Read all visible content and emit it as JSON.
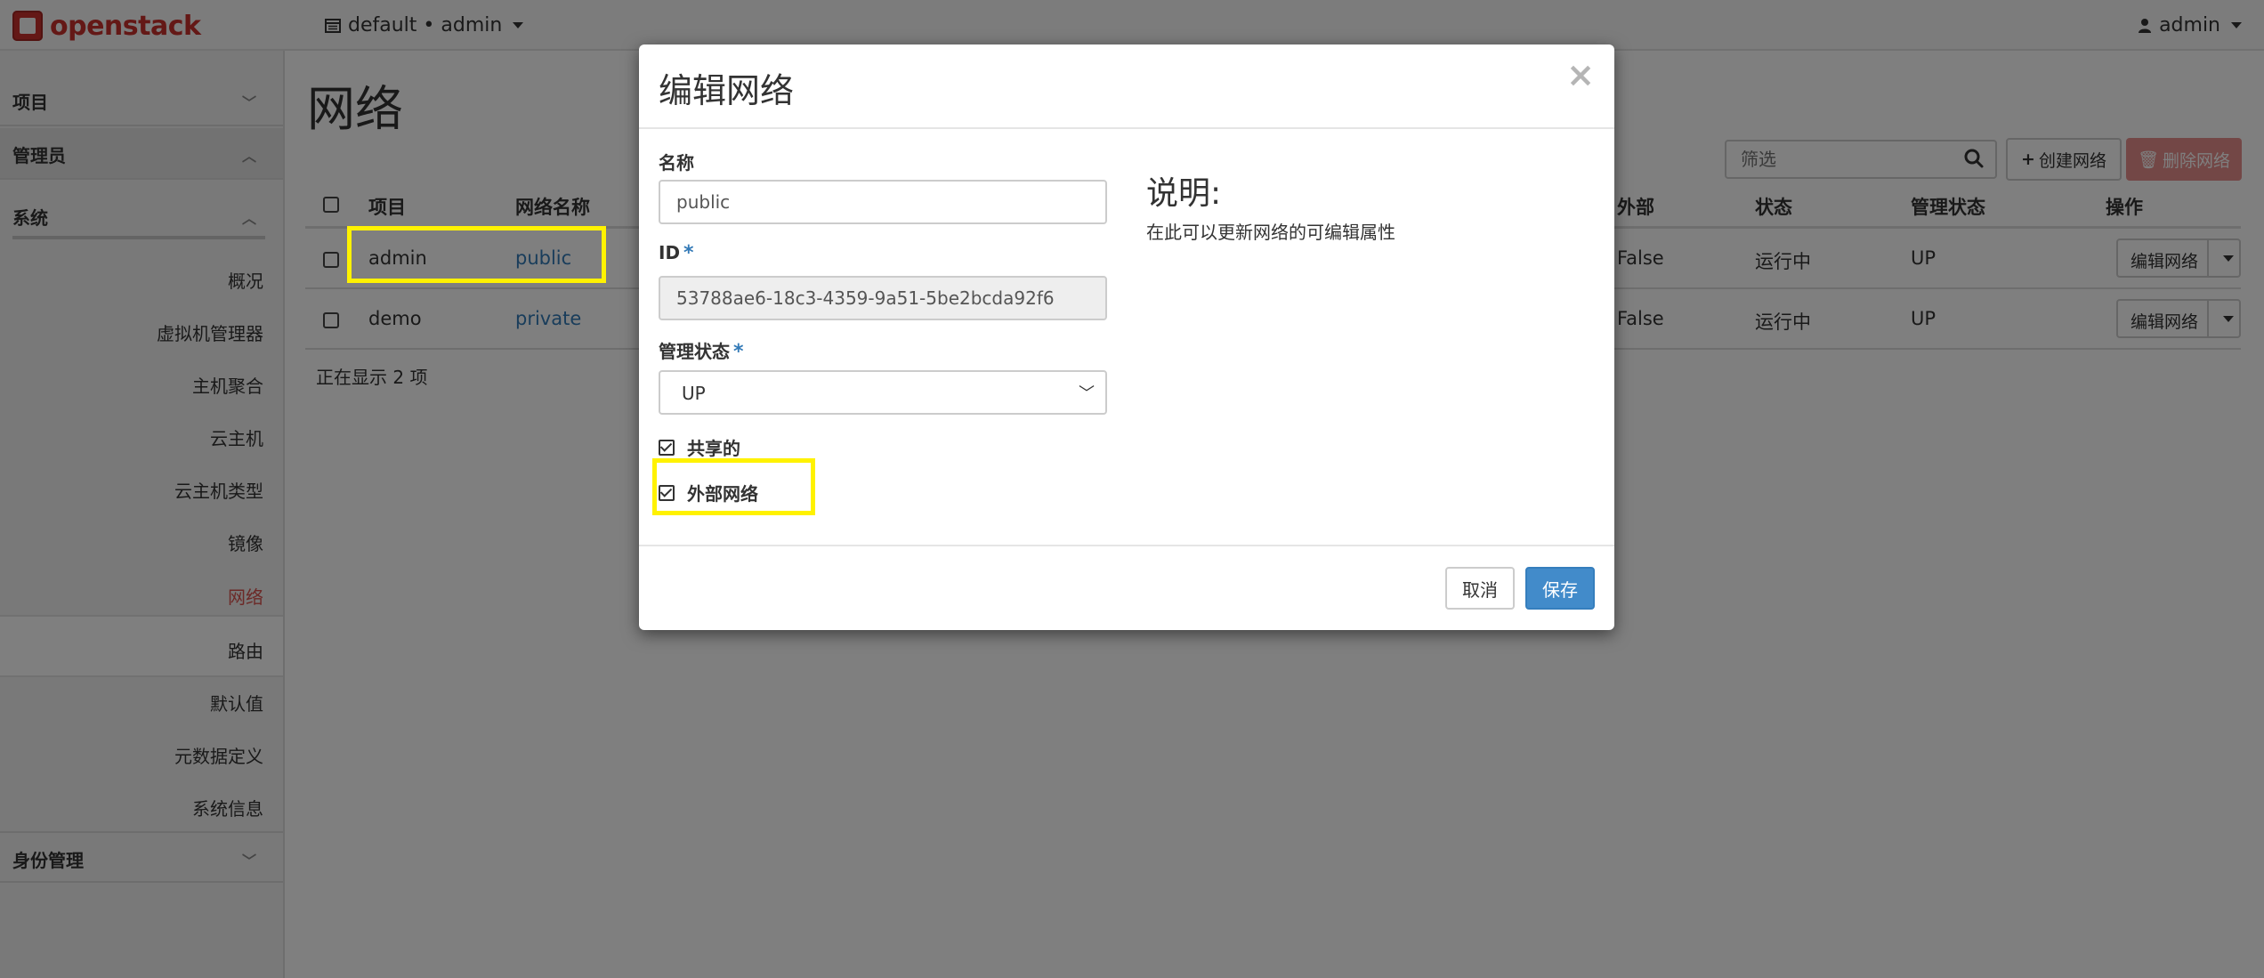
{
  "topbar": {
    "brand": "openstack",
    "project_switch": "default • admin",
    "user": "admin"
  },
  "sidebar": {
    "sections": [
      {
        "label": "项目",
        "expanded": false
      },
      {
        "label": "管理员",
        "expanded": true
      },
      {
        "label": "系统",
        "expanded": true
      },
      {
        "label": "身份管理",
        "expanded": false
      }
    ],
    "items": [
      {
        "label": "概况"
      },
      {
        "label": "虚拟机管理器"
      },
      {
        "label": "主机聚合"
      },
      {
        "label": "云主机"
      },
      {
        "label": "云主机类型"
      },
      {
        "label": "镜像"
      },
      {
        "label": "网络",
        "selected": true
      },
      {
        "label": "路由"
      },
      {
        "label": "默认值"
      },
      {
        "label": "元数据定义"
      },
      {
        "label": "系统信息"
      }
    ]
  },
  "main": {
    "title": "网络",
    "filter_placeholder": "筛选",
    "create_label": "创建网络",
    "delete_label": "删除网络",
    "columns": [
      "项目",
      "网络名称",
      "外部",
      "状态",
      "管理状态",
      "操作"
    ],
    "rows": [
      {
        "project": "admin",
        "name": "public",
        "external": "False",
        "status": "运行中",
        "admin_state": "UP",
        "action": "编辑网络"
      },
      {
        "project": "demo",
        "name": "private",
        "external": "False",
        "status": "运行中",
        "admin_state": "UP",
        "action": "编辑网络"
      }
    ],
    "showing": "正在显示 2 项"
  },
  "modal": {
    "title": "编辑网络",
    "close": "×",
    "name_label": "名称",
    "name_value": "public",
    "id_label": "ID",
    "id_value": "53788ae6-18c3-4359-9a51-5be2bcda92f6",
    "required_mark": "*",
    "admin_state_label": "管理状态",
    "admin_state_value": "UP",
    "shared_label": "共享的",
    "shared_checked": true,
    "external_label": "外部网络",
    "external_checked": true,
    "desc_title": "说明:",
    "desc_text": "在此可以更新网络的可编辑属性",
    "cancel_label": "取消",
    "save_label": "保存"
  },
  "colors": {
    "brand": "#c9302c",
    "link": "#337ab7",
    "primary": "#428bca",
    "danger": "#d9534f",
    "highlight": "#fff200"
  }
}
